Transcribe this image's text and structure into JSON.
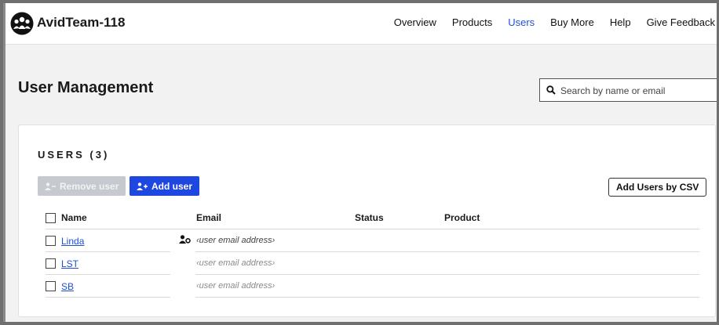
{
  "app": {
    "title": "AvidTeam-118",
    "logo_icon": "team-people-icon"
  },
  "nav": {
    "items": [
      "Overview",
      "Products",
      "Users",
      "Buy More",
      "Help",
      "Give Feedback"
    ],
    "active": "Users",
    "active_color": "#1f4fd8"
  },
  "page": {
    "title": "User Management"
  },
  "search": {
    "placeholder": "Search by name or email",
    "value": "",
    "icon": "search-icon"
  },
  "users_section": {
    "title": "USERS (3)",
    "remove_label": "Remove user",
    "add_label": "Add user",
    "csv_label": "Add Users by CSV",
    "accent": "#1d47e0"
  },
  "table": {
    "columns": [
      "Name",
      "Email",
      "Status",
      "Product"
    ],
    "rows": [
      {
        "name": "Linda",
        "email": "‹user email address›",
        "status": "",
        "product": "",
        "icon": "admin-user-icon"
      },
      {
        "name": "LST",
        "email": "‹user email address›",
        "status": "",
        "product": ""
      },
      {
        "name": "SB",
        "email": "‹user email address›",
        "status": "",
        "product": ""
      }
    ]
  }
}
